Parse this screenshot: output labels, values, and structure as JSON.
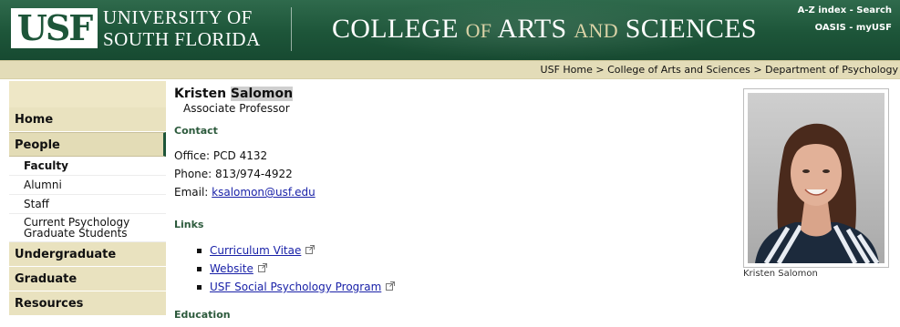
{
  "header": {
    "logo_text": "USF",
    "university_line1": "UNIVERSITY OF",
    "university_line2": "SOUTH FLORIDA",
    "college_part1": "COLLEGE",
    "college_of": "OF",
    "college_part2": "ARTS",
    "college_and": "AND",
    "college_part3": "SCIENCES",
    "top_links": {
      "az_index": "A-Z index",
      "search": "Search",
      "oasis": "OASIS",
      "myusf": "myUSF",
      "separator": " - "
    }
  },
  "breadcrumb": {
    "items": [
      "USF Home",
      "College of Arts and Sciences",
      "Department of Psychology"
    ],
    "separator": " > "
  },
  "sidebar": {
    "items": [
      {
        "label": "Home"
      },
      {
        "label": "People"
      },
      {
        "label": "Faculty"
      },
      {
        "label": "Alumni"
      },
      {
        "label": "Staff"
      },
      {
        "label": "Current Psychology Graduate Students"
      },
      {
        "label": "Undergraduate"
      },
      {
        "label": "Graduate"
      },
      {
        "label": "Resources"
      }
    ]
  },
  "profile": {
    "first_name": "Kristen",
    "last_name": "Salomon",
    "title": "Associate Professor",
    "contact_heading": "Contact",
    "office_label": "Office:",
    "office": "PCD 4132",
    "phone_label": "Phone:",
    "phone": "813/974-4922",
    "email_label": "Email:",
    "email": "ksalomon@usf.edu",
    "links_heading": "Links",
    "links": [
      {
        "label": "Curriculum Vitae"
      },
      {
        "label": "Website"
      },
      {
        "label": "USF Social Psychology Program"
      }
    ],
    "education_heading": "Education",
    "photo_caption": "Kristen Salomon"
  },
  "colors": {
    "header_green": "#1d5539",
    "nav_tan": "#e9e2bf",
    "section_heading": "#2c5a3c",
    "link_blue": "#1a22a8"
  },
  "icons": {
    "external_link": "external-link-icon"
  }
}
